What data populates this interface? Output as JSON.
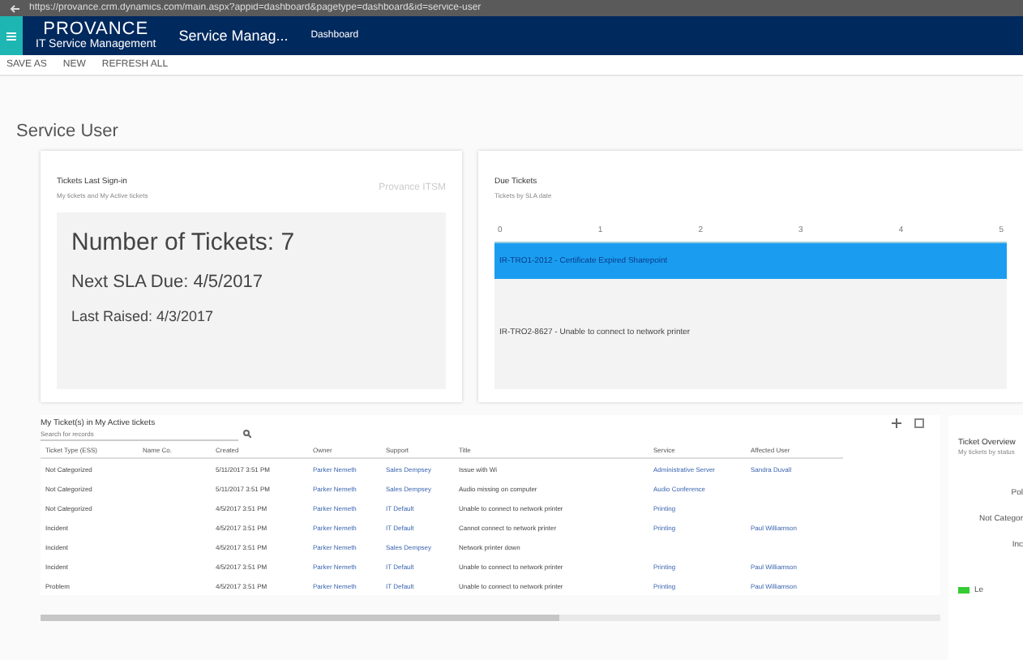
{
  "browser": {
    "url": "https://provance.crm.dynamics.com/main.aspx?appid=dashboard&pagetype=dashboard&id=service-user"
  },
  "nav": {
    "logo": "PROVANCE",
    "logo_sub": "IT Service Management",
    "app": "Service Manag...",
    "area": "Dashboard"
  },
  "commands": [
    "SAVE AS",
    "NEW",
    "REFRESH ALL"
  ],
  "dashboard_title": "Service User",
  "summary_card": {
    "title": "Tickets Last Sign-in",
    "subtitle": "My tickets and My Active tickets",
    "watermark": "Provance ITSM",
    "lines": [
      {
        "kind": "large",
        "text": "Number of Tickets: 7"
      },
      {
        "kind": "medium",
        "text": "Next SLA Due: 4/5/2017"
      },
      {
        "kind": "small",
        "text": "Last Raised: 4/3/2017"
      }
    ]
  },
  "timeline_card": {
    "title": "Due Tickets",
    "subtitle": "Tickets by SLA date",
    "ticks": [
      "0",
      "1",
      "2",
      "3",
      "4",
      "5"
    ],
    "rows": [
      {
        "text": "IR-TRO1-2012 - Certificate Expired Sharepoint",
        "selected": true
      },
      {
        "text": "IR-TRO2-8627 - Unable to connect to network printer",
        "selected": false
      }
    ]
  },
  "grid": {
    "title": "My Ticket(s) in My Active tickets",
    "search_placeholder": "Search for records",
    "columns": [
      "Ticket Type (ESS)",
      "Name Co.",
      "Created",
      "Owner",
      "Support",
      "Title",
      "Service",
      "Affected User"
    ],
    "rows": [
      [
        "Not Categorized",
        "",
        "5/11/2017 3:51 PM",
        "Parker Nemeth",
        "Sales Dempsey",
        "Issue with Wi",
        "Administrative Server",
        "Sandra Duvall"
      ],
      [
        "Not Categorized",
        "",
        "5/11/2017 3:51 PM",
        "Parker Nemeth",
        "Sales Dempsey",
        "Audio missing on computer",
        "Audio Conference",
        ""
      ],
      [
        "Not Categorized",
        "",
        "4/5/2017 3:51 PM",
        "Parker Nemeth",
        "IT Default",
        "Unable to connect to network printer",
        "Printing",
        ""
      ],
      [
        "Incident",
        "",
        "4/5/2017 3:51 PM",
        "Parker Nemeth",
        "IT Default",
        "Cannot connect to network printer",
        "Printing",
        "Paul Williamson"
      ],
      [
        "Incident",
        "",
        "4/5/2017 3:51 PM",
        "Parker Nemeth",
        "Sales Dempsey",
        "Network printer down",
        "",
        ""
      ],
      [
        "Incident",
        "",
        "4/5/2017 3:51 PM",
        "Parker Nemeth",
        "IT Default",
        "Unable to connect to network printer",
        "Printing",
        "Paul Williamson"
      ],
      [
        "Problem",
        "",
        "4/5/2017 3:51 PM",
        "Parker Nemeth",
        "IT Default",
        "Unable to connect to network printer",
        "Printing",
        "Paul Williamson"
      ]
    ]
  },
  "side_card": {
    "title": "Ticket Overview",
    "subtitle": "My tickets by status",
    "labels": [
      "Pol",
      "Not Categor",
      "Inc"
    ],
    "legend": "Le"
  }
}
